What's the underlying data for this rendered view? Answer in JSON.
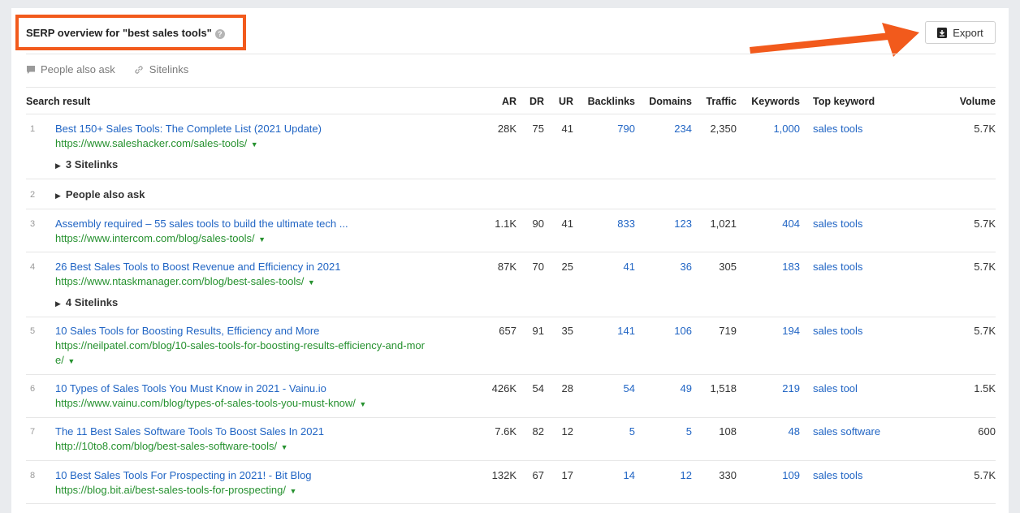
{
  "header": {
    "title": "SERP overview for \"best sales tools\"",
    "help_icon": "?",
    "export_label": "Export"
  },
  "filters": {
    "people_also_ask": "People also ask",
    "sitelinks": "Sitelinks"
  },
  "columns": {
    "search_result": "Search result",
    "ar": "AR",
    "dr": "DR",
    "ur": "UR",
    "backlinks": "Backlinks",
    "domains": "Domains",
    "traffic": "Traffic",
    "keywords": "Keywords",
    "top_keyword": "Top keyword",
    "volume": "Volume"
  },
  "rows": [
    {
      "num": "1",
      "title": "Best 150+ Sales Tools: The Complete List (2021 Update)",
      "url": "https://www.saleshacker.com/sales-tools/",
      "ar": "28K",
      "dr": "75",
      "ur": "41",
      "backlinks": "790",
      "domains": "234",
      "traffic": "2,350",
      "keywords": "1,000",
      "top_keyword": "sales tools",
      "volume": "5.7K",
      "sitelinks": "3 Sitelinks"
    },
    {
      "num": "2",
      "people_also_ask": "People also ask"
    },
    {
      "num": "3",
      "title": "Assembly required – 55 sales tools to build the ultimate tech ...",
      "url": "https://www.intercom.com/blog/sales-tools/",
      "ar": "1.1K",
      "dr": "90",
      "ur": "41",
      "backlinks": "833",
      "domains": "123",
      "traffic": "1,021",
      "keywords": "404",
      "top_keyword": "sales tools",
      "volume": "5.7K"
    },
    {
      "num": "4",
      "title": "26 Best Sales Tools to Boost Revenue and Efficiency in 2021",
      "url": "https://www.ntaskmanager.com/blog/best-sales-tools/",
      "ar": "87K",
      "dr": "70",
      "ur": "25",
      "backlinks": "41",
      "domains": "36",
      "traffic": "305",
      "keywords": "183",
      "top_keyword": "sales tools",
      "volume": "5.7K",
      "sitelinks": "4 Sitelinks"
    },
    {
      "num": "5",
      "title": "10 Sales Tools for Boosting Results, Efficiency and More",
      "url_line1": "https://neilpatel.com/blog/10-sales-tools-for-boosting-results-efficiency-and-mor",
      "url_line2": "e/",
      "ar": "657",
      "dr": "91",
      "ur": "35",
      "backlinks": "141",
      "domains": "106",
      "traffic": "719",
      "keywords": "194",
      "top_keyword": "sales tools",
      "volume": "5.7K"
    },
    {
      "num": "6",
      "title": "10 Types of Sales Tools You Must Know in 2021 - Vainu.io",
      "url": "https://www.vainu.com/blog/types-of-sales-tools-you-must-know/",
      "ar": "426K",
      "dr": "54",
      "ur": "28",
      "backlinks": "54",
      "domains": "49",
      "traffic": "1,518",
      "keywords": "219",
      "top_keyword": "sales tool",
      "volume": "1.5K"
    },
    {
      "num": "7",
      "title": "The 11 Best Sales Software Tools To Boost Sales In 2021",
      "url": "http://10to8.com/blog/best-sales-software-tools/",
      "ar": "7.6K",
      "dr": "82",
      "ur": "12",
      "backlinks": "5",
      "domains": "5",
      "traffic": "108",
      "keywords": "48",
      "top_keyword": "sales software",
      "volume": "600"
    },
    {
      "num": "8",
      "title": "10 Best Sales Tools For Prospecting in 2021! - Bit Blog",
      "url": "https://blog.bit.ai/best-sales-tools-for-prospecting/",
      "ar": "132K",
      "dr": "67",
      "ur": "17",
      "backlinks": "14",
      "domains": "12",
      "traffic": "330",
      "keywords": "109",
      "top_keyword": "sales tools",
      "volume": "5.7K"
    }
  ],
  "colors": {
    "highlight": "#f25a1c",
    "link": "#2165c4",
    "url": "#26912f"
  }
}
